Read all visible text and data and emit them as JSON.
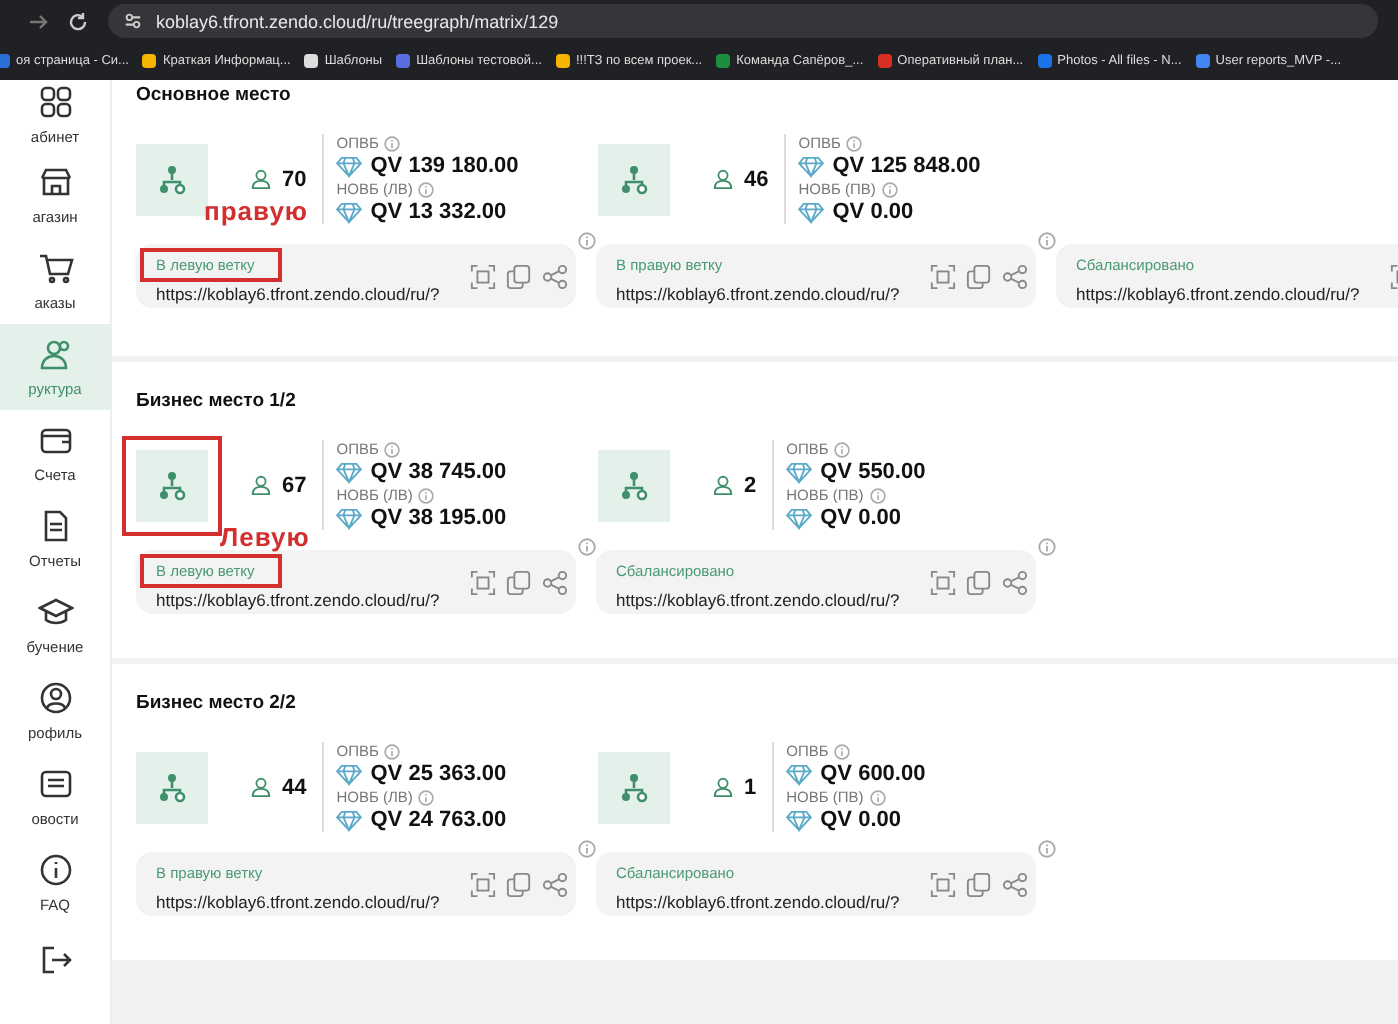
{
  "browser": {
    "url": "koblay6.tfront.zendo.cloud/ru/treegraph/matrix/129",
    "bookmarks": [
      {
        "label": "оя страница - Си...",
        "color": "#2a6fd6"
      },
      {
        "label": "Краткая Информац...",
        "color": "#f4b400"
      },
      {
        "label": "Шаблоны",
        "color": "#dddddd"
      },
      {
        "label": "Шаблоны тестовой...",
        "color": "#5b6ee1"
      },
      {
        "label": "!!!ТЗ по всем проек...",
        "color": "#f4b400"
      },
      {
        "label": "Команда Сапёров_...",
        "color": "#1e8e3e"
      },
      {
        "label": "Оперативный план...",
        "color": "#d93025"
      },
      {
        "label": "Photos - All files - N...",
        "color": "#1a73e8"
      },
      {
        "label": "User reports_MVP -...",
        "color": "#4285f4"
      }
    ]
  },
  "sidebar": {
    "items": [
      {
        "label": "абинет",
        "kind": "grid",
        "selected": false
      },
      {
        "label": "агазин",
        "kind": "shop",
        "selected": false
      },
      {
        "label": "аказы",
        "kind": "cart",
        "selected": false
      },
      {
        "label": "руктура",
        "kind": "people",
        "selected": true
      },
      {
        "label": "Счета",
        "kind": "wallet",
        "selected": false
      },
      {
        "label": "Отчеты",
        "kind": "doc",
        "selected": false
      },
      {
        "label": "бучение",
        "kind": "cap",
        "selected": false
      },
      {
        "label": "рофиль",
        "kind": "user",
        "selected": false
      },
      {
        "label": "овости",
        "kind": "news",
        "selected": false
      },
      {
        "label": "FAQ",
        "kind": "info",
        "selected": false
      },
      {
        "kind": "exit",
        "selected": false
      }
    ]
  },
  "sections": [
    {
      "title": "Основное место",
      "annotation": "правую",
      "nodes": [
        {
          "count": "70",
          "opvb_label": "ОПВБ",
          "opvb": "QV 139 180.00",
          "novb_label": "НОВБ (ЛВ)",
          "novb": "QV 13 332.00",
          "highlighted": false
        },
        {
          "count": "46",
          "opvb_label": "ОПВБ",
          "opvb": "QV 125 848.00",
          "novb_label": "НОВБ (ПВ)",
          "novb": "QV 0.00",
          "highlighted": false
        }
      ],
      "links": [
        {
          "label": "В левую ветку",
          "url": "https://koblay6.tfront.zendo.cloud/ru/?",
          "highlighted": true
        },
        {
          "label": "В правую ветку",
          "url": "https://koblay6.tfront.zendo.cloud/ru/?",
          "highlighted": false
        },
        {
          "label": "Сбалансировано",
          "url": "https://koblay6.tfront.zendo.cloud/ru/?",
          "highlighted": false
        }
      ]
    },
    {
      "title": "Бизнес место 1/2",
      "annotation": "Левую",
      "nodes": [
        {
          "count": "67",
          "opvb_label": "ОПВБ",
          "opvb": "QV 38 745.00",
          "novb_label": "НОВБ (ЛВ)",
          "novb": "QV 38 195.00",
          "highlighted": true
        },
        {
          "count": "2",
          "opvb_label": "ОПВБ",
          "opvb": "QV 550.00",
          "novb_label": "НОВБ (ПВ)",
          "novb": "QV 0.00",
          "highlighted": false
        }
      ],
      "links": [
        {
          "label": "В левую ветку",
          "url": "https://koblay6.tfront.zendo.cloud/ru/?",
          "highlighted": true
        },
        {
          "label": "Сбалансировано",
          "url": "https://koblay6.tfront.zendo.cloud/ru/?",
          "highlighted": false
        }
      ]
    },
    {
      "title": "Бизнес место 2/2",
      "nodes": [
        {
          "count": "44",
          "opvb_label": "ОПВБ",
          "opvb": "QV 25 363.00",
          "novb_label": "НОВБ (ЛВ)",
          "novb": "QV 24 763.00",
          "highlighted": false
        },
        {
          "count": "1",
          "opvb_label": "ОПВБ",
          "opvb": "QV 600.00",
          "novb_label": "НОВБ (ПВ)",
          "novb": "QV 0.00",
          "highlighted": false
        }
      ],
      "links": [
        {
          "label": "В правую ветку",
          "url": "https://koblay6.tfront.zendo.cloud/ru/?",
          "highlighted": false
        },
        {
          "label": "Сбалансировано",
          "url": "https://koblay6.tfront.zendo.cloud/ru/?",
          "highlighted": false
        }
      ]
    }
  ]
}
